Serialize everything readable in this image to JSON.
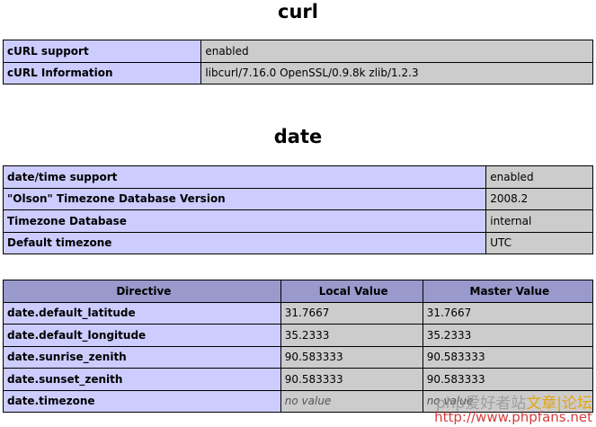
{
  "curl": {
    "title": "curl",
    "rows": [
      {
        "key": "cURL support",
        "value": "enabled"
      },
      {
        "key": "cURL Information",
        "value": "libcurl/7.16.0 OpenSSL/0.9.8k zlib/1.2.3"
      }
    ]
  },
  "date": {
    "title": "date",
    "rows": [
      {
        "key": "date/time support",
        "value": "enabled"
      },
      {
        "key": "\"Olson\" Timezone Database Version",
        "value": "2008.2"
      },
      {
        "key": "Timezone Database",
        "value": "internal"
      },
      {
        "key": "Default timezone",
        "value": "UTC"
      }
    ],
    "directives": {
      "headers": {
        "directive": "Directive",
        "local": "Local Value",
        "master": "Master Value"
      },
      "rows": [
        {
          "name": "date.default_latitude",
          "local": "31.7667",
          "master": "31.7667"
        },
        {
          "name": "date.default_longitude",
          "local": "35.2333",
          "master": "35.2333"
        },
        {
          "name": "date.sunrise_zenith",
          "local": "90.583333",
          "master": "90.583333"
        },
        {
          "name": "date.sunset_zenith",
          "local": "90.583333",
          "master": "90.583333"
        },
        {
          "name": "date.timezone",
          "local": "no value",
          "master": "no value"
        }
      ]
    }
  },
  "watermark": {
    "line1_prefix": "php爱好者站",
    "line1_suffix": "文章|论坛",
    "line2": "http://www.phpfans.net"
  },
  "colors": {
    "header": "#9999cc",
    "key_cell": "#ccccff",
    "value_cell": "#cccccc",
    "border": "#000000"
  }
}
